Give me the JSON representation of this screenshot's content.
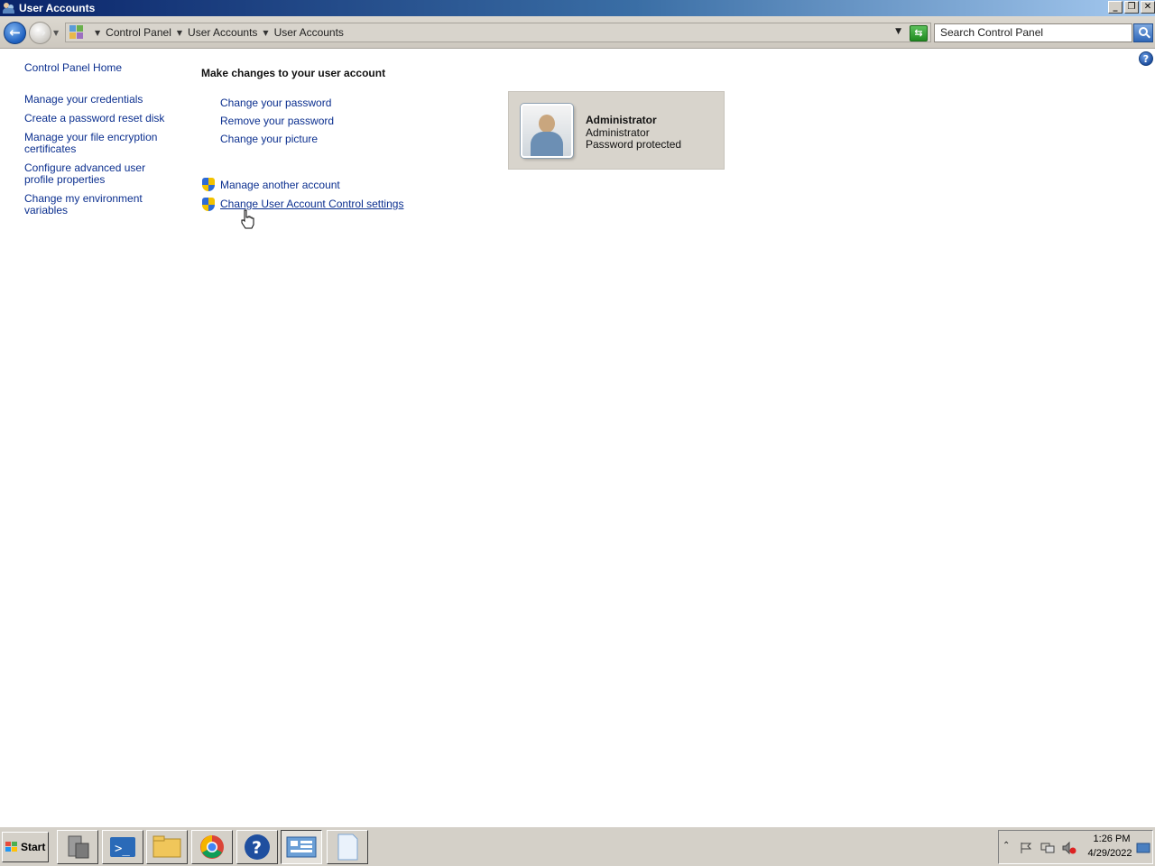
{
  "window": {
    "title": "User Accounts"
  },
  "address_bar": {
    "breadcrumbs": [
      "Control Panel",
      "User Accounts",
      "User Accounts"
    ],
    "search_placeholder": "Search Control Panel"
  },
  "sidebar": {
    "home_link": "Control Panel Home",
    "links": [
      "Manage your credentials",
      "Create a password reset disk",
      "Manage your file encryption certificates",
      "Configure advanced user profile properties",
      "Change my environment variables"
    ]
  },
  "main": {
    "heading": "Make changes to your user account",
    "tasks": [
      "Change your password",
      "Remove your password",
      "Change your picture"
    ],
    "admin_tasks": [
      "Manage another account",
      "Change User Account Control settings"
    ]
  },
  "account": {
    "name": "Administrator",
    "type": "Administrator",
    "status": "Password protected"
  },
  "taskbar": {
    "start_label": "Start",
    "clock_time": "1:26 PM",
    "clock_date": "4/29/2022"
  },
  "colors": {
    "link": "#0b2f8f",
    "titlebar_start": "#0a246a",
    "titlebar_end": "#a6caf0",
    "tile_background": "#d8d4cc"
  }
}
